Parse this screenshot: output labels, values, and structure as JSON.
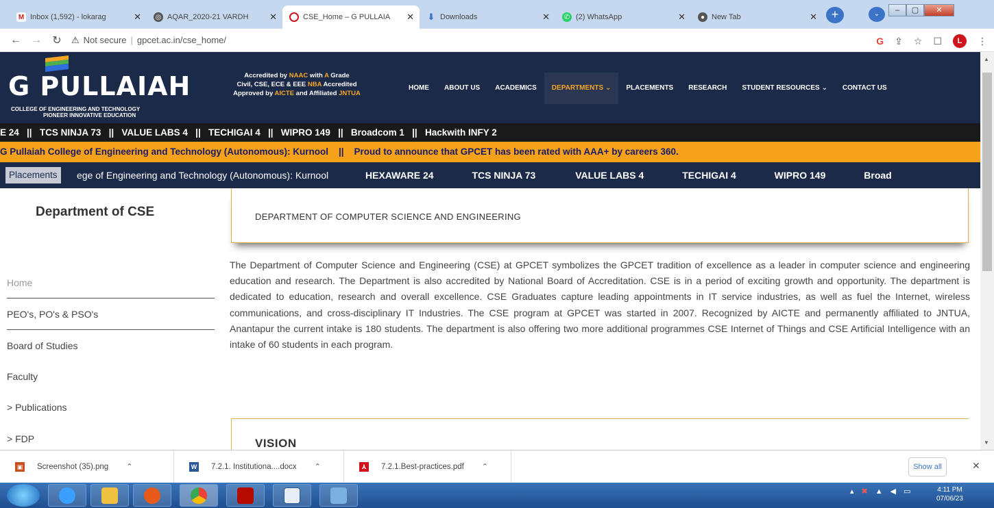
{
  "browser": {
    "tabs": [
      {
        "label": "Inbox (1,592) - lokarag",
        "icon": "gmail-icon",
        "color": "#c5221f"
      },
      {
        "label": "AQAR_2020-21 VARDH",
        "icon": "globe-icon",
        "color": "#555555"
      },
      {
        "label": "CSE_Home – G PULLAIA",
        "icon": "site-icon",
        "color": "#d0121b",
        "active": true
      },
      {
        "label": "Downloads",
        "icon": "download-icon",
        "color": "#3b73c7"
      },
      {
        "label": "(2) WhatsApp",
        "icon": "whatsapp-icon",
        "color": "#25d366"
      },
      {
        "label": "New Tab",
        "icon": "chrome-icon",
        "color": "#555555"
      }
    ],
    "new_tab": "+",
    "security_label": "Not secure",
    "url": "gpcet.ac.in/cse_home/"
  },
  "header": {
    "logo_text": "G PULLAIAH",
    "logo_sub1": "COLLEGE OF ENGINEERING AND TECHNOLOGY",
    "logo_sub2": "PIONEER INNOVATIVE EDUCATION",
    "accr_1a": "Accredited by ",
    "accr_1b": "NAAC",
    "accr_1c": " with ",
    "accr_1d": "A",
    "accr_1e": " Grade",
    "accr_2a": "Civil, CSE, ECE & EEE ",
    "accr_2b": "NBA",
    "accr_2c": " Accredited",
    "accr_3a": "Approved by ",
    "accr_3b": "AICTE",
    "accr_3c": " and Affiliated ",
    "accr_3d": "JNTUA",
    "nav": [
      "HOME",
      "ABOUT US",
      "ACADEMICS",
      "DEPARTMENTS ⌄",
      "PLACEMENTS",
      "RESEARCH",
      "STUDENT RESOURCES ⌄",
      "CONTACT US"
    ]
  },
  "ticker1": "E 24   ||   TCS NINJA 73   ||   VALUE LABS 4   ||   TECHIGAI 4   ||   WIPRO 149   ||   Broadcom 1   ||   Hackwith INFY 2",
  "ticker2": "G Pullaiah College of Engineering and Technology (Autonomous): Kurnool    ||    Proud to announce that GPCET has been rated with AAA+ by careers 360.",
  "ticker3": {
    "label": "Placements",
    "lead": "ege of Engineering and Technology (Autonomous): Kurnool",
    "items": [
      "HEXAWARE 24",
      "TCS NINJA 73",
      "VALUE LABS 4",
      "TECHIGAI 4",
      "WIPRO 149",
      "Broad"
    ]
  },
  "sidebar": {
    "title": "Department of CSE",
    "items": [
      "Home",
      "PEO's, PO's & PSO's",
      "Board of Studies",
      "Faculty",
      "> Publications",
      "> FDP"
    ]
  },
  "content": {
    "heading": "DEPARTMENT OF COMPUTER SCIENCE AND ENGINEERING",
    "paragraph": "The Department of Computer Science and Engineering (CSE) at GPCET symbolizes the GPCET tradition of excellence as a leader in computer science and engineering education and research. The Department is also accredited by National Board of Accreditation. CSE is in a period of exciting growth and opportunity. The department is dedicated to education, research and overall excellence. CSE Graduates capture leading appointments in IT service industries, as well as fuel the Internet, wireless communications, and cross-disciplinary IT Industries. The CSE program at GPCET was started in 2007. Recognized by AICTE and permanently affiliated to JNTUA, Anantapur the current intake is 180 students. The department is also offering two more additional programmes CSE Internet of Things and CSE Artificial Intelligence with an intake of 60 students in each program.",
    "vision_title": "VISION"
  },
  "downloads": {
    "items": [
      {
        "name": "Screenshot (35).png",
        "icon": "image-file-icon",
        "color": "#c94f1d"
      },
      {
        "name": "7.2.1. Institutiona....docx",
        "icon": "word-file-icon",
        "color": "#2b5797"
      },
      {
        "name": "7.2.1.Best-practices.pdf",
        "icon": "pdf-file-icon",
        "color": "#d0121b"
      }
    ],
    "show_all": "Show all"
  },
  "taskbar": {
    "time": "4:11 PM",
    "date": "07/06/23"
  },
  "colors": {
    "header_bg": "#1c2a4a",
    "accent": "#f5a21a",
    "ticker_dark": "#1a1a1a"
  }
}
